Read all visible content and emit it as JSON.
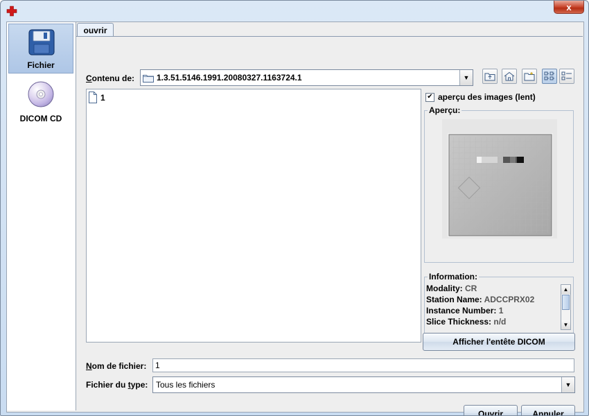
{
  "window": {
    "close_label": "x"
  },
  "sidebar": {
    "items": [
      {
        "label": "Fichier"
      },
      {
        "label": "DICOM CD"
      }
    ]
  },
  "tab": {
    "label": "ouvrir"
  },
  "location": {
    "label_pre": "C",
    "label_post": "ontenu de:",
    "value": "1.3.51.5146.1991.20080327.1163724.1"
  },
  "files": [
    {
      "name": "1"
    }
  ],
  "preview": {
    "checkbox_label": "aperçu des images (lent)",
    "checked": true,
    "group_title": "Aperçu:"
  },
  "information": {
    "title": "Information:",
    "rows": [
      {
        "key": "Modality:",
        "value": "CR"
      },
      {
        "key": "Station Name:",
        "value": "ADCCPRX02"
      },
      {
        "key": "Instance Number:",
        "value": "1"
      },
      {
        "key": "Slice Thickness:",
        "value": "n/d"
      }
    ]
  },
  "header_button": {
    "label": "Afficher l'entête DICOM"
  },
  "filename": {
    "label_pre": "N",
    "label_post": "om de fichier:",
    "value": "1"
  },
  "filetype": {
    "label_pre": "Fichier du ",
    "label_u": "t",
    "label_post": "ype:",
    "value": "Tous les fichiers"
  },
  "buttons": {
    "open": "Ouvrir",
    "cancel": "Annuler"
  },
  "colors": {
    "accent": "#c7d9ef",
    "close": "#c9462d"
  }
}
